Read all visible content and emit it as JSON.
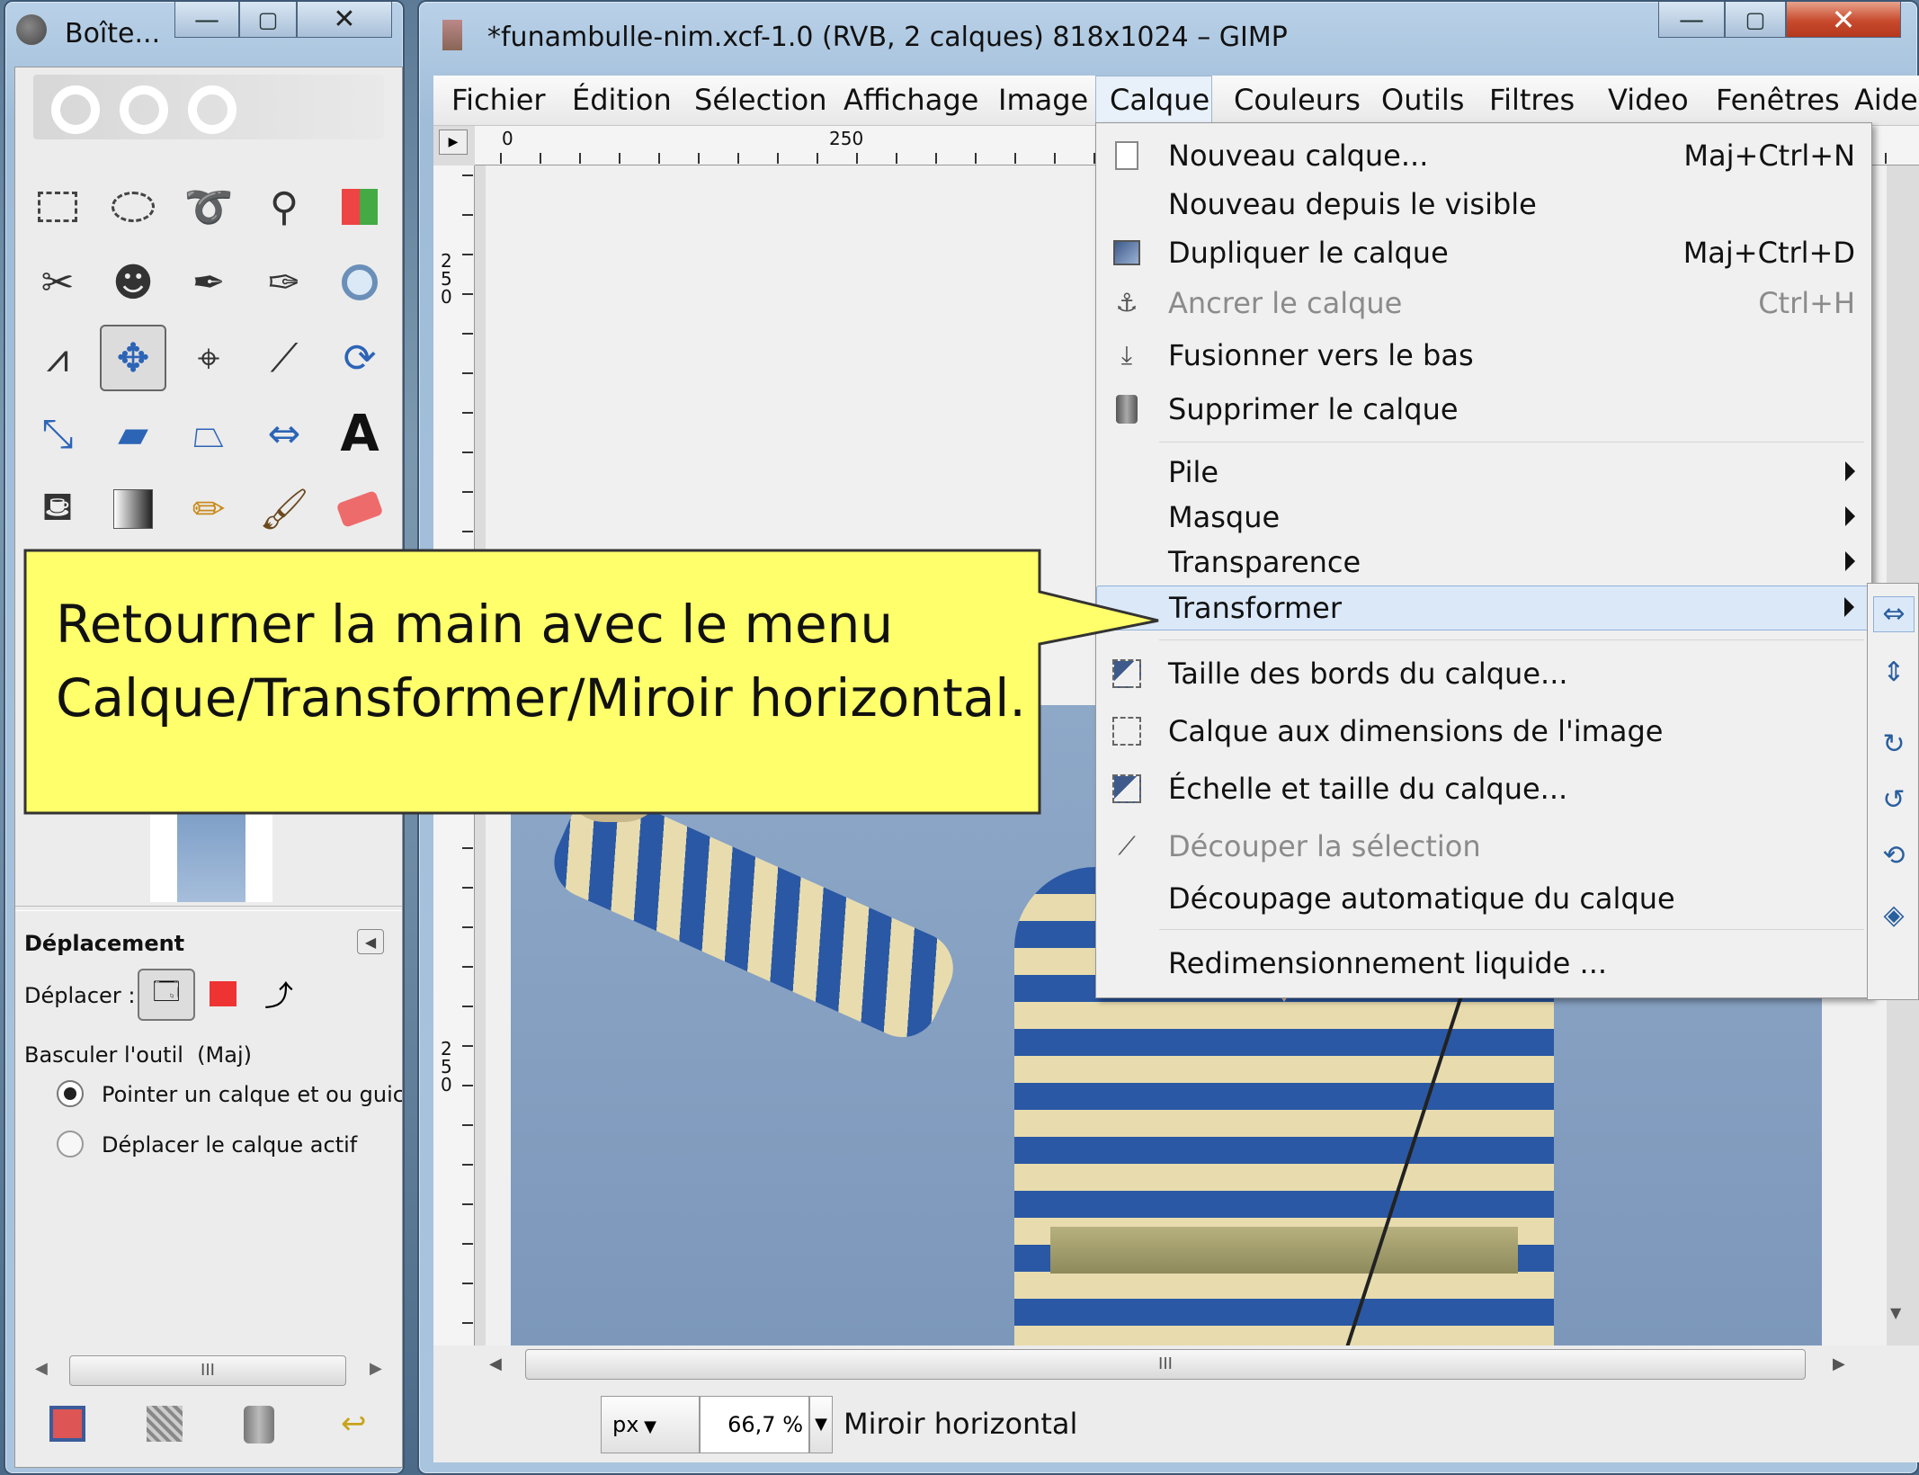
{
  "toolbox": {
    "title": "Boîte...",
    "tool_options_title": "Déplacement",
    "move_label": "Déplacer :",
    "toggle_label": "Basculer l'outil  (Maj)",
    "radio1": "Pointer un calque et ou guic",
    "radio2": "Déplacer le calque actif",
    "scroll_thumb": "III"
  },
  "main": {
    "title": "*funambulle-nim.xcf-1.0 (RVB, 2 calques) 818x1024 – GIMP",
    "menus": {
      "fichier": "Fichier",
      "edition": "Édition",
      "selection": "Sélection",
      "affichage": "Affichage",
      "image": "Image",
      "calque": "Calque",
      "couleurs": "Couleurs",
      "outils": "Outils",
      "filtres": "Filtres",
      "video": "Video",
      "fenetres": "Fenêtres",
      "aide": "Aide"
    },
    "ruler_h": {
      "t0": "0",
      "t250": "250"
    },
    "ruler_v": {
      "t250a": "2\n5\n0",
      "t250b": "2\n5\n0"
    },
    "unit": "px",
    "zoom": "66,7 %",
    "status": "Miroir horizontal",
    "scroll_thumb": "III"
  },
  "calque_menu": {
    "nouveau": "Nouveau calque...",
    "nouveau_sc": "Maj+Ctrl+N",
    "visible": "Nouveau depuis le visible",
    "dupliquer": "Dupliquer le calque",
    "dupliquer_sc": "Maj+Ctrl+D",
    "ancrer": "Ancrer le calque",
    "ancrer_sc": "Ctrl+H",
    "fusionner": "Fusionner vers le bas",
    "supprimer": "Supprimer le calque",
    "pile": "Pile",
    "masque": "Masque",
    "transparence": "Transparence",
    "transformer": "Transformer",
    "taille_bords": "Taille des bords du calque...",
    "dims_image": "Calque aux dimensions de l'image",
    "echelle": "Échelle et taille du calque...",
    "decouper": "Découper la sélection",
    "decoupage_auto": "Découpage automatique du calque",
    "redim_liquide": "Redimensionnement liquide ..."
  },
  "callout": {
    "line1": "Retourner la main avec le menu",
    "line2": "Calque/Transformer/Miroir horizontal."
  },
  "colors": {
    "callout_bg": "#ffff6b",
    "callout_border": "#333333",
    "highlight": "#d9e7f7",
    "sky": "#8fa8c6"
  }
}
